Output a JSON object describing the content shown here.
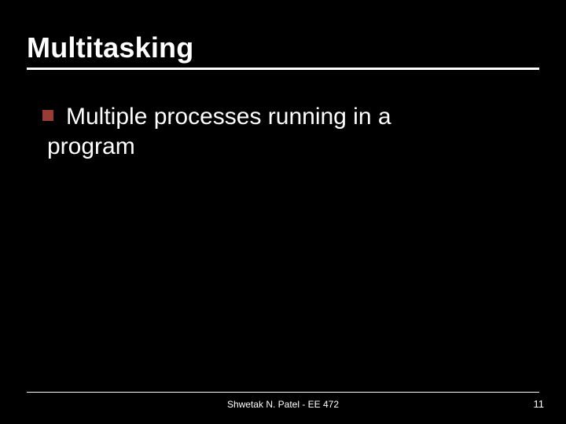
{
  "title": "Multitasking",
  "bullets": [
    {
      "line1": "Multiple processes running in a",
      "line2": "program"
    }
  ],
  "footer": {
    "center": "Shwetak N. Patel - EE 472",
    "page": "11"
  },
  "colors": {
    "accent": "#9a3b35"
  }
}
